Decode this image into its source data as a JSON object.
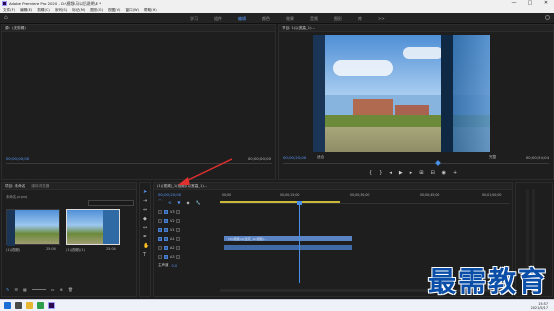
{
  "window": {
    "title": "Adobe Premiere Pro 2020 - D:\\视频\\马以后说明\\E *",
    "min_label": "—",
    "max_label": "□",
    "close_label": "✕"
  },
  "menu": [
    "文件(F)",
    "编辑(E)",
    "剪辑(C)",
    "序列(S)",
    "标记(M)",
    "图形(G)",
    "视图(V)",
    "窗口(W)",
    "帮助(H)"
  ],
  "workspace": {
    "tabs": [
      "学习",
      "组件",
      "编辑",
      "颜色",
      "效果",
      "音频",
      "图形",
      "库"
    ],
    "active_index": 2,
    "more_label": ">>"
  },
  "source_panel": {
    "title": "源：(无剪辑)",
    "timecode_left": "00;00;00;00",
    "timecode_right": "00;00;00;00"
  },
  "program_panel": {
    "title": "节目: 1(以宽高_1)...",
    "timecode_left": "00;00;20;00",
    "fit_label": "适合",
    "zoom_label": "完整",
    "timecode_right": "00;00;54;04"
  },
  "project_panel": {
    "tabs": [
      "项目: 未命名",
      "媒体浏览器"
    ],
    "path_label": "未命名.prproj",
    "items": [
      {
        "name": "(1)(视频)",
        "duration": "25:04"
      },
      {
        "name": "(1)(视频)(1)",
        "duration": "25:04"
      }
    ]
  },
  "timeline_panel": {
    "tab_label": "(1)(视频)_1(视频)(以宽高_1)...",
    "timecode": "00;00;20;00",
    "ruler_marks": [
      "00;00",
      "00;00;15;00",
      "00;00;30;00",
      "00;00;45;00",
      "00;01;00;00"
    ],
    "tracks": [
      {
        "name": "V3"
      },
      {
        "name": "V2"
      },
      {
        "name": "V1"
      },
      {
        "name": "A1"
      },
      {
        "name": "A2"
      },
      {
        "name": "A3"
      },
      {
        "name": "主声道",
        "value": "0.0"
      }
    ],
    "clip_label": "(1)(视频)(以宽高_1)(视频)..."
  },
  "taskbar": {
    "time": "15:57",
    "date": "2021/5/17"
  },
  "watermark": {
    "text": "最需教育"
  },
  "colors": {
    "accent": "#5a9bff",
    "clip_video": "#5b84c4",
    "playhead": "#4a8fe8",
    "watermark": "#0a4ea8"
  }
}
